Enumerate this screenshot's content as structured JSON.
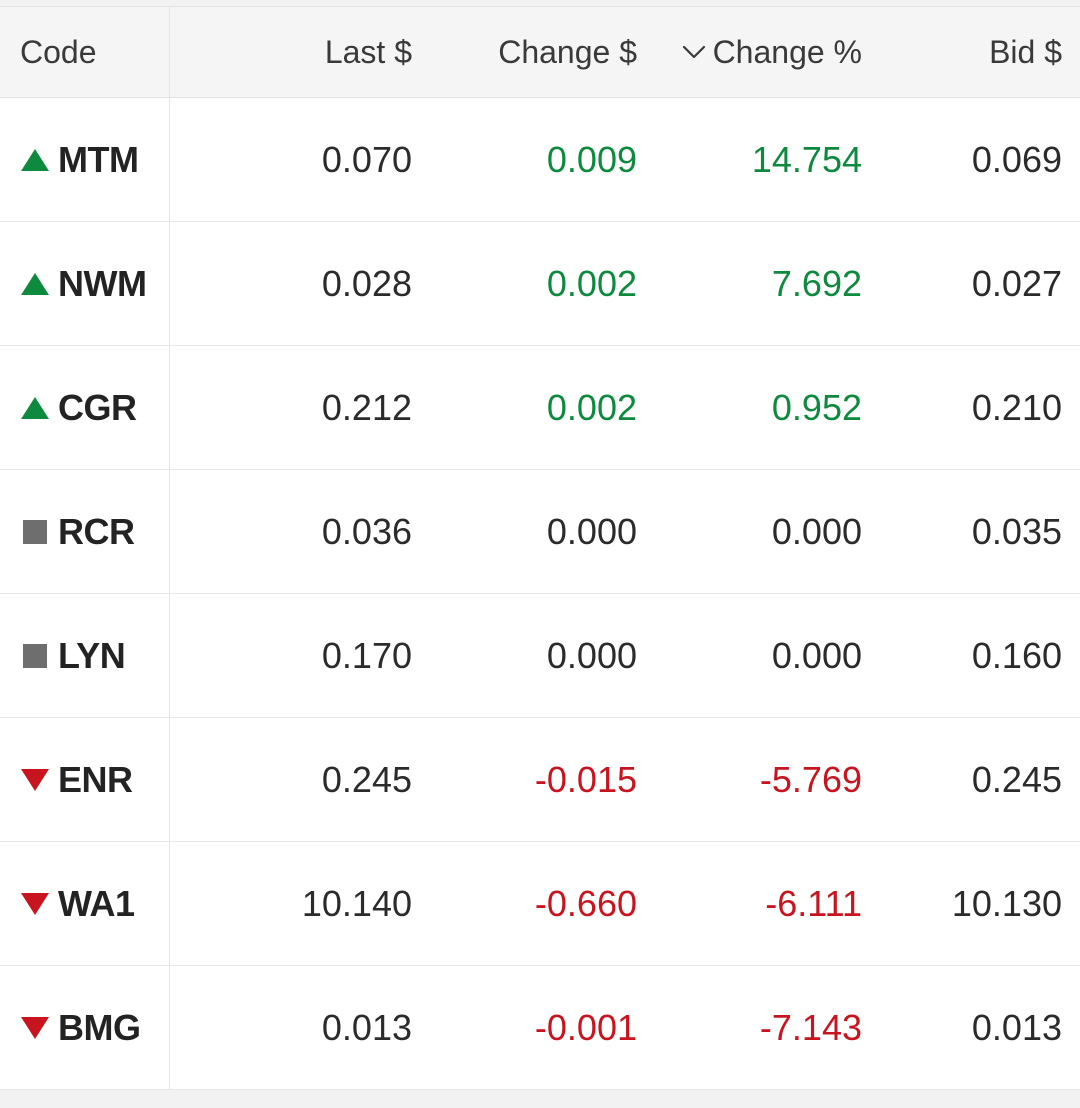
{
  "colors": {
    "up": "#0e8a3e",
    "down": "#c8141e",
    "flat": "#6e6e6e",
    "header_bg": "#f5f5f5"
  },
  "header": {
    "code": "Code",
    "last": "Last $",
    "change": "Change $",
    "change_pct": "Change %",
    "bid": "Bid $",
    "sort_icon": "chevron-down-icon"
  },
  "rows": [
    {
      "trend": "up",
      "icon": "triangle-up-icon",
      "code": "MTM",
      "last": "0.070",
      "change": "0.009",
      "change_pct": "14.754",
      "bid": "0.069"
    },
    {
      "trend": "up",
      "icon": "triangle-up-icon",
      "code": "NWM",
      "last": "0.028",
      "change": "0.002",
      "change_pct": "7.692",
      "bid": "0.027"
    },
    {
      "trend": "up",
      "icon": "triangle-up-icon",
      "code": "CGR",
      "last": "0.212",
      "change": "0.002",
      "change_pct": "0.952",
      "bid": "0.210"
    },
    {
      "trend": "flat",
      "icon": "square-icon",
      "code": "RCR",
      "last": "0.036",
      "change": "0.000",
      "change_pct": "0.000",
      "bid": "0.035"
    },
    {
      "trend": "flat",
      "icon": "square-icon",
      "code": "LYN",
      "last": "0.170",
      "change": "0.000",
      "change_pct": "0.000",
      "bid": "0.160"
    },
    {
      "trend": "down",
      "icon": "triangle-down-icon",
      "code": "ENR",
      "last": "0.245",
      "change": "-0.015",
      "change_pct": "-5.769",
      "bid": "0.245"
    },
    {
      "trend": "down",
      "icon": "triangle-down-icon",
      "code": "WA1",
      "last": "10.140",
      "change": "-0.660",
      "change_pct": "-6.111",
      "bid": "10.130"
    },
    {
      "trend": "down",
      "icon": "triangle-down-icon",
      "code": "BMG",
      "last": "0.013",
      "change": "-0.001",
      "change_pct": "-7.143",
      "bid": "0.013"
    }
  ]
}
